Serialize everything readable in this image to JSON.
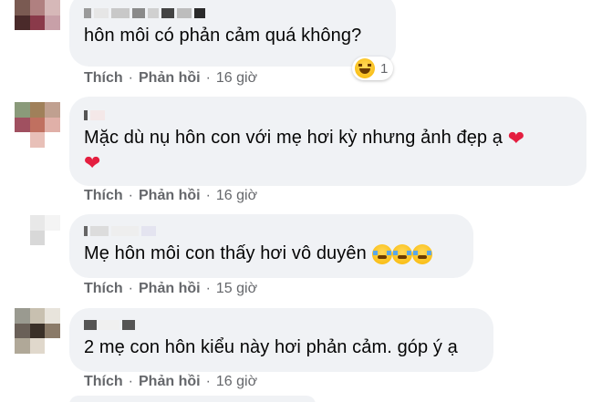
{
  "comments": [
    {
      "text": "hôn môi có phản cảm quá không?",
      "actions": {
        "like": "Thích",
        "reply": "Phản hồi",
        "time": "16 giờ"
      },
      "reaction": {
        "icon": "laughing-emoji",
        "count": "1"
      }
    },
    {
      "text": "Mặc dù nụ hôn con với mẹ hơi kỳ nhưng ảnh đẹp ạ",
      "text_icons": [
        "heart-icon",
        "heart-icon"
      ],
      "actions": {
        "like": "Thích",
        "reply": "Phản hồi",
        "time": "16 giờ"
      }
    },
    {
      "text": "Mẹ hôn môi con thấy hơi vô duyên",
      "text_icons": [
        "tears-emoji",
        "tears-emoji",
        "tears-emoji"
      ],
      "actions": {
        "like": "Thích",
        "reply": "Phản hồi",
        "time": "15 giờ"
      }
    },
    {
      "text": "2 mẹ con hôn kiểu này hơi phản cảm. góp ý ạ",
      "actions": {
        "like": "Thích",
        "reply": "Phản hồi",
        "time": "16 giờ"
      }
    }
  ],
  "separator": "·",
  "colors": {
    "bubble": "#f0f2f5",
    "meta_text": "#65676b",
    "heart": "#e41e3f"
  }
}
